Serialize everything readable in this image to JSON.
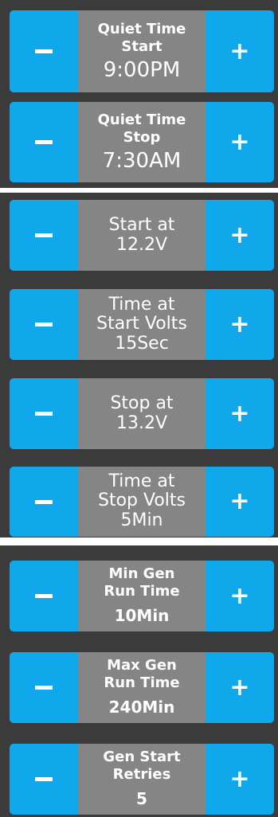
{
  "quiet_time": [
    {
      "label_line1": "Quiet Time",
      "label_line2": "Start",
      "value": "9:00PM",
      "minus": "−",
      "plus": "+"
    },
    {
      "label_line1": "Quiet Time",
      "label_line2": "Stop",
      "value": "7:30AM",
      "minus": "−",
      "plus": "+"
    }
  ],
  "voltage": [
    {
      "label_line1": "Start at",
      "label_line2": "",
      "value": "12.2V",
      "minus": "−",
      "plus": "+"
    },
    {
      "label_line1": "Time at",
      "label_line2": "Start Volts",
      "value": "15Sec",
      "minus": "−",
      "plus": "+"
    },
    {
      "label_line1": "Stop at",
      "label_line2": "",
      "value": "13.2V",
      "minus": "−",
      "plus": "+"
    },
    {
      "label_line1": "Time at",
      "label_line2": "Stop Volts",
      "value": "5Min",
      "minus": "−",
      "plus": "+"
    }
  ],
  "generator": [
    {
      "label_line1": "Min Gen",
      "label_line2": "Run Time",
      "value": "10Min",
      "minus": "−",
      "plus": "+"
    },
    {
      "label_line1": "Max Gen",
      "label_line2": "Run Time",
      "value": "240Min",
      "minus": "−",
      "plus": "+"
    },
    {
      "label_line1": "Gen Start",
      "label_line2": "Retries",
      "value": "5",
      "minus": "−",
      "plus": "+"
    }
  ],
  "colors": {
    "button": "#0fa8eb",
    "display": "#858585",
    "panel": "#3b3b3b"
  }
}
